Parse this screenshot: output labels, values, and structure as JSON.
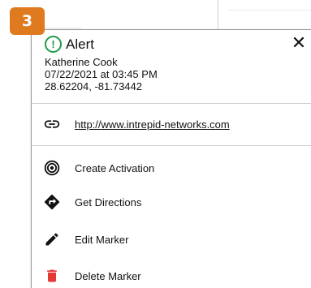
{
  "step_badge": "3",
  "popup": {
    "title": "Alert",
    "close_icon": "close-icon",
    "name": "Katherine Cook",
    "datetime": "07/22/2021 at 03:45 PM",
    "coordinates": "28.62204, -81.73442",
    "link": "http://www.intrepid-networks.com",
    "actions": [
      {
        "label": "Create Activation",
        "icon": "target-icon"
      },
      {
        "label": "Get Directions",
        "icon": "directions-icon"
      },
      {
        "label": "Edit Marker",
        "icon": "pencil-icon"
      },
      {
        "label": "Delete Marker",
        "icon": "trash-icon"
      }
    ]
  },
  "colors": {
    "badge": "#e07a1f",
    "alert_green": "#1f9a4a",
    "delete_red": "#e53935"
  }
}
